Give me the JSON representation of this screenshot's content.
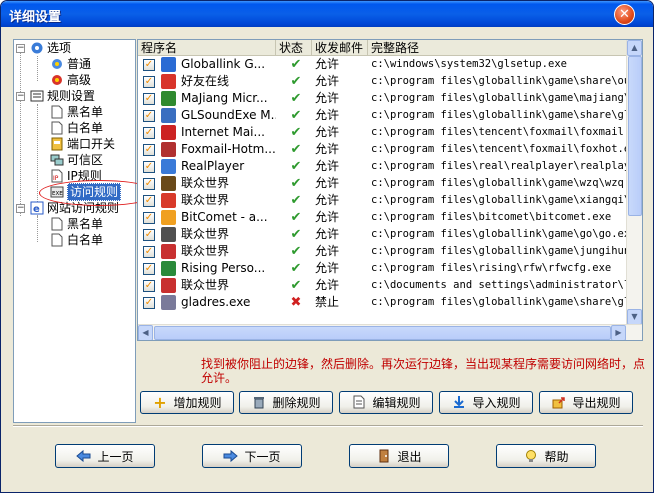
{
  "window": {
    "title": "详细设置"
  },
  "tree": {
    "items": [
      {
        "label": "选项"
      },
      {
        "label": "普通"
      },
      {
        "label": "高级"
      },
      {
        "label": "规则设置"
      },
      {
        "label": "黑名单"
      },
      {
        "label": "白名单"
      },
      {
        "label": "端口开关"
      },
      {
        "label": "可信区"
      },
      {
        "label": "IP规则"
      },
      {
        "label": "访问规则"
      },
      {
        "label": "网站访问规则"
      },
      {
        "label": "黑名单"
      },
      {
        "label": "白名单"
      }
    ]
  },
  "list": {
    "columns": [
      "程序名",
      "状态",
      "收发邮件",
      "完整路径"
    ],
    "rows": [
      {
        "name": "Globallink G...",
        "status": "✔",
        "mail": "允许",
        "path": "c:\\windows\\system32\\glsetup.exe",
        "icon": "globallink-icon",
        "color": "#2a6bd4"
      },
      {
        "name": "好友在线",
        "status": "✔",
        "mail": "允许",
        "path": "c:\\program files\\globallink\\game\\share\\ou...",
        "icon": "friends-icon",
        "color": "#d8342a"
      },
      {
        "name": "MaJiang Micr...",
        "status": "✔",
        "mail": "允许",
        "path": "c:\\program files\\globallink\\game\\majiang\\...",
        "icon": "mahjong-icon",
        "color": "#2f8a2f"
      },
      {
        "name": "GLSoundExe M...",
        "status": "✔",
        "mail": "允许",
        "path": "c:\\program files\\globallink\\game\\share\\gl...",
        "icon": "sound-icon",
        "color": "#3a6ec0"
      },
      {
        "name": "Internet Mai...",
        "status": "✔",
        "mail": "允许",
        "path": "c:\\program files\\tencent\\foxmail\\foxmail.exe",
        "icon": "foxmail-icon",
        "color": "#cc2222"
      },
      {
        "name": "Foxmail-Hotm...",
        "status": "✔",
        "mail": "允许",
        "path": "c:\\program files\\tencent\\foxmail\\foxhot.exe",
        "icon": "foxhot-icon",
        "color": "#b03030"
      },
      {
        "name": "RealPlayer",
        "status": "✔",
        "mail": "允许",
        "path": "c:\\program files\\real\\realplayer\\realplay...",
        "icon": "realplayer-icon",
        "color": "#3a7ad8"
      },
      {
        "name": "联众世界",
        "status": "✔",
        "mail": "允许",
        "path": "c:\\program files\\globallink\\game\\wzq\\wzq.exe",
        "icon": "game-wzq-icon",
        "color": "#6a4a1a"
      },
      {
        "name": "联众世界",
        "status": "✔",
        "mail": "允许",
        "path": "c:\\program files\\globallink\\game\\xiangqi\\...",
        "icon": "game-xiangqi-icon",
        "color": "#d83a2a"
      },
      {
        "name": "BitComet - a...",
        "status": "✔",
        "mail": "允许",
        "path": "c:\\program files\\bitcomet\\bitcomet.exe",
        "icon": "bitcomet-icon",
        "color": "#f0a020"
      },
      {
        "name": "联众世界",
        "status": "✔",
        "mail": "允许",
        "path": "c:\\program files\\globallink\\game\\go\\go.exe",
        "icon": "game-go-icon",
        "color": "#505050"
      },
      {
        "name": "联众世界",
        "status": "✔",
        "mail": "允许",
        "path": "c:\\program files\\globallink\\game\\jungihun...",
        "icon": "game-jungi-icon",
        "color": "#c83030"
      },
      {
        "name": "Rising Perso...",
        "status": "✔",
        "mail": "允许",
        "path": "c:\\program files\\rising\\rfw\\rfwcfg.exe",
        "icon": "rising-icon",
        "color": "#2a8a3a"
      },
      {
        "name": "联众世界",
        "status": "✔",
        "mail": "允许",
        "path": "c:\\documents and settings\\administrator\\l...",
        "icon": "game-doc-icon",
        "color": "#c83030"
      },
      {
        "name": "gladres.exe",
        "status": "✖",
        "mail": "禁止",
        "path": "c:\\program files\\globallink\\game\\share\\gl...",
        "icon": "exe-icon",
        "color": "#7a7a9a"
      }
    ]
  },
  "hint": "找到被你阻止的边锋，然后删除。再次运行边锋，当出现某程序需要访问网络时，点允许。",
  "actions": {
    "add": "增加规则",
    "delete": "删除规则",
    "edit": "编辑规则",
    "import": "导入规则",
    "export": "导出规则"
  },
  "footer": {
    "prev": "上一页",
    "next": "下一页",
    "exit": "退出",
    "help": "帮助"
  },
  "colors": {
    "accent": "#0058ee",
    "check": "#2e9a2e",
    "deny": "#d02020",
    "hint": "#c00000"
  }
}
